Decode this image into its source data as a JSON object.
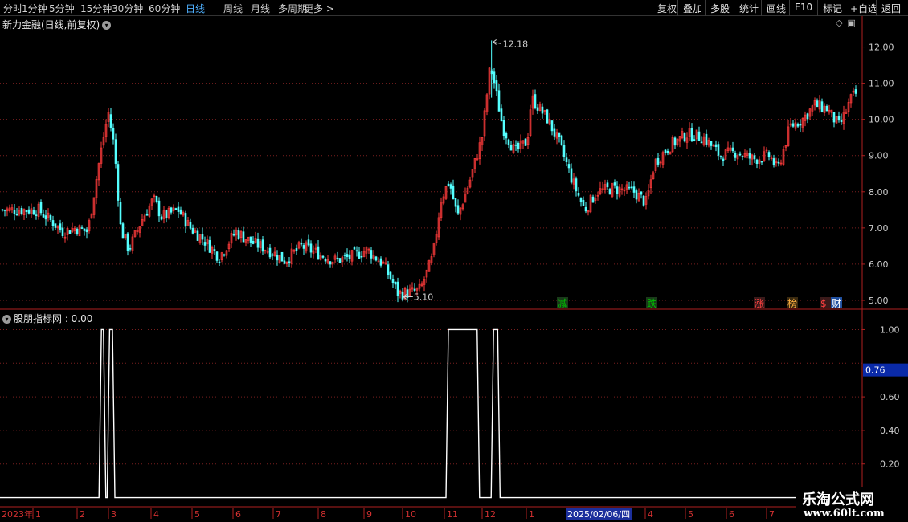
{
  "toolbar": {
    "left_items": [
      "分时",
      "1分钟",
      "5分钟",
      "15分钟",
      "30分钟",
      "60分钟",
      "日线",
      "周线",
      "月线",
      "多周期",
      "更多 >"
    ],
    "active_index": 6,
    "right_items": [
      "复权",
      "叠加",
      "多股",
      "统计",
      "画线",
      "F10",
      "标记",
      "+自选",
      "返回"
    ]
  },
  "price_panel": {
    "title": "新力金融(日线,前复权)",
    "dropdown_icon": "chevron-down-icon",
    "header_icons": [
      "diamond-icon",
      "panel-toggle-icon"
    ],
    "high_label": "12.18",
    "low_label": "5.10",
    "markers": [
      {
        "text": "减",
        "color": "#00c000",
        "bg": "#1a3a1a",
        "month": "2024-12"
      },
      {
        "text": "跌",
        "color": "#00c000",
        "bg": "#1a3a1a",
        "month": "2025-03"
      },
      {
        "text": "涨",
        "color": "#ff4040",
        "bg": "#3a1a1a",
        "month": "2025-06"
      },
      {
        "text": "榜",
        "color": "#ffb040",
        "bg": "#3a2a10",
        "month": "2025-06"
      },
      {
        "text": "$",
        "color": "#ff4040",
        "bg": "#3a1a1a",
        "month": "2025-07"
      },
      {
        "text": "财",
        "color": "#ffffff",
        "bg": "#2050a0",
        "month": "2025-07"
      }
    ]
  },
  "indicator_panel": {
    "title": "股朋指标网 : 0.00",
    "dropdown_icon": "chevron-down-icon",
    "current_value_label": "0.76"
  },
  "x_axis": {
    "labels": [
      "2023年",
      "1",
      "2",
      "3",
      "4",
      "5",
      "6",
      "7",
      "8",
      "9",
      "10",
      "11",
      "12",
      "1",
      "2025/02/06/四",
      "4",
      "5",
      "6",
      "7"
    ],
    "highlight_label": "2025/02/06/四"
  },
  "watermark": {
    "logo": "乐淘公式网",
    "url": "www.60lt.com"
  },
  "colors": {
    "up": "#ff3b3b",
    "down": "#54ffff",
    "grid": "#7a1f1f",
    "axis": "#b02020",
    "indicator_line": "#ffffff",
    "value_tag_bg": "#0a2aa8"
  },
  "chart_data": [
    {
      "type": "candlestick",
      "title": "新力金融(日线,前复权)",
      "y_ticks": [
        5.0,
        6.0,
        7.0,
        8.0,
        9.0,
        10.0,
        11.0,
        12.0
      ],
      "ylim": [
        4.8,
        12.5
      ],
      "x": [
        "2023-12",
        "2024-01",
        "2024-02",
        "2024-03",
        "2024-04",
        "2024-05",
        "2024-06",
        "2024-07",
        "2024-08",
        "2024-09",
        "2024-10",
        "2024-11",
        "2024-12",
        "2025-01",
        "2025-02",
        "2025-03",
        "2025-04",
        "2025-05",
        "2025-06",
        "2025-07"
      ],
      "close_path": [
        {
          "m": 0.0,
          "v": 7.5
        },
        {
          "m": 0.3,
          "v": 7.2
        },
        {
          "m": 0.6,
          "v": 6.9
        },
        {
          "m": 0.9,
          "v": 7.0
        },
        {
          "m": 1.2,
          "v": 6.9
        },
        {
          "m": 1.5,
          "v": 9.0
        },
        {
          "m": 1.7,
          "v": 10.2
        },
        {
          "m": 1.85,
          "v": 9.2
        },
        {
          "m": 2.0,
          "v": 7.0
        },
        {
          "m": 2.2,
          "v": 6.4
        },
        {
          "m": 2.5,
          "v": 7.2
        },
        {
          "m": 2.8,
          "v": 7.8
        },
        {
          "m": 3.0,
          "v": 7.3
        },
        {
          "m": 3.4,
          "v": 7.5
        },
        {
          "m": 3.7,
          "v": 7.0
        },
        {
          "m": 4.0,
          "v": 6.7
        },
        {
          "m": 4.4,
          "v": 6.2
        },
        {
          "m": 4.8,
          "v": 6.9
        },
        {
          "m": 5.2,
          "v": 6.6
        },
        {
          "m": 5.6,
          "v": 6.4
        },
        {
          "m": 6.0,
          "v": 6.1
        },
        {
          "m": 6.4,
          "v": 6.5
        },
        {
          "m": 6.8,
          "v": 6.3
        },
        {
          "m": 7.2,
          "v": 6.1
        },
        {
          "m": 7.6,
          "v": 6.2
        },
        {
          "m": 8.0,
          "v": 6.4
        },
        {
          "m": 8.4,
          "v": 6.0
        },
        {
          "m": 8.75,
          "v": 5.2
        },
        {
          "m": 9.0,
          "v": 5.2
        },
        {
          "m": 9.3,
          "v": 5.3
        },
        {
          "m": 9.6,
          "v": 6.2
        },
        {
          "m": 9.8,
          "v": 7.8
        },
        {
          "m": 10.0,
          "v": 8.3
        },
        {
          "m": 10.2,
          "v": 7.3
        },
        {
          "m": 10.5,
          "v": 8.3
        },
        {
          "m": 10.8,
          "v": 9.5
        },
        {
          "m": 11.0,
          "v": 11.5
        },
        {
          "m": 11.1,
          "v": 11.0
        },
        {
          "m": 11.3,
          "v": 9.8
        },
        {
          "m": 11.6,
          "v": 9.1
        },
        {
          "m": 11.9,
          "v": 9.4
        },
        {
          "m": 12.0,
          "v": 10.6
        },
        {
          "m": 12.4,
          "v": 10.0
        },
        {
          "m": 12.7,
          "v": 9.3
        },
        {
          "m": 13.0,
          "v": 8.3
        },
        {
          "m": 13.3,
          "v": 7.5
        },
        {
          "m": 13.6,
          "v": 8.0
        },
        {
          "m": 14.0,
          "v": 8.1
        },
        {
          "m": 14.5,
          "v": 8.0
        },
        {
          "m": 14.8,
          "v": 7.7
        },
        {
          "m": 15.0,
          "v": 8.8
        },
        {
          "m": 15.4,
          "v": 9.3
        },
        {
          "m": 15.8,
          "v": 9.6
        },
        {
          "m": 16.2,
          "v": 9.5
        },
        {
          "m": 16.6,
          "v": 9.0
        },
        {
          "m": 17.0,
          "v": 9.1
        },
        {
          "m": 17.4,
          "v": 8.9
        },
        {
          "m": 17.8,
          "v": 9.0
        },
        {
          "m": 18.0,
          "v": 8.6
        },
        {
          "m": 18.3,
          "v": 9.8
        },
        {
          "m": 18.6,
          "v": 10.0
        },
        {
          "m": 18.9,
          "v": 10.4
        },
        {
          "m": 19.2,
          "v": 10.3
        },
        {
          "m": 19.5,
          "v": 9.8
        },
        {
          "m": 19.8,
          "v": 10.6
        },
        {
          "m": 20.2,
          "v": 11.0
        }
      ],
      "high_marker": {
        "m": 11.05,
        "v": 12.18
      },
      "low_marker": {
        "m": 8.9,
        "v": 5.1
      }
    },
    {
      "type": "line",
      "title": "股朋指标网",
      "y_ticks": [
        0.2,
        0.4,
        0.6,
        1.0
      ],
      "ylim": [
        -0.05,
        1.05
      ],
      "signal_intervals": [
        {
          "start": 1.55,
          "end": 1.6,
          "v": 1.0
        },
        {
          "start": 1.75,
          "end": 1.82,
          "v": 1.0
        },
        {
          "start": 10.0,
          "end": 10.7,
          "v": 1.0
        },
        {
          "start": 11.1,
          "end": 11.2,
          "v": 1.0
        }
      ],
      "current_value": 0.76
    }
  ]
}
